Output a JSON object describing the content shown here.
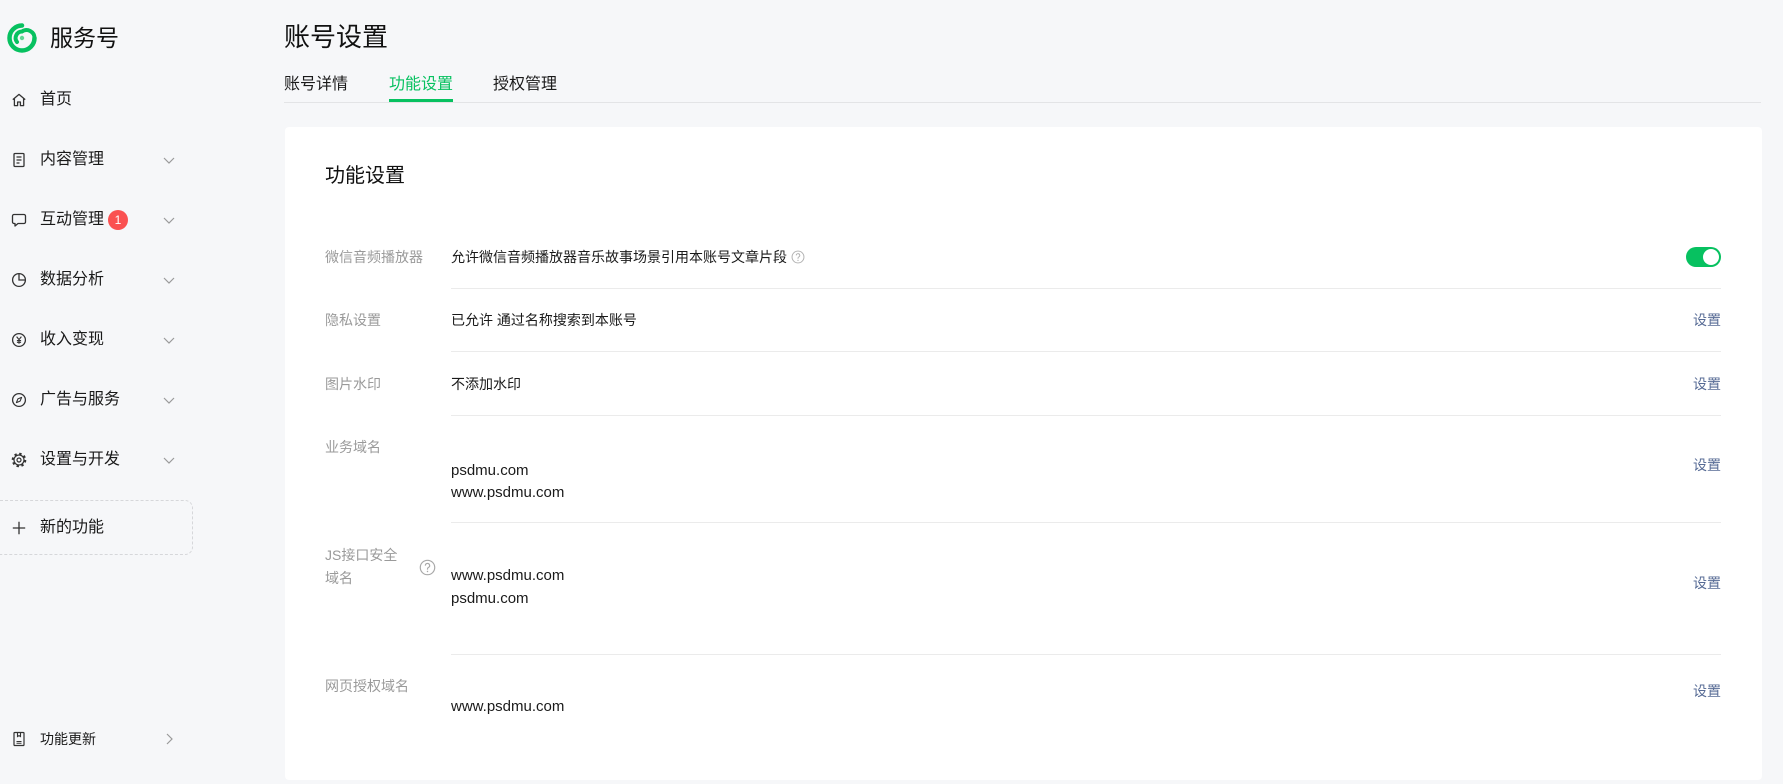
{
  "app": {
    "name": "服务号",
    "logo": "service-account-logo"
  },
  "sidebar": {
    "items": [
      {
        "label": "首页",
        "icon": "home-icon"
      },
      {
        "label": "内容管理",
        "icon": "document-icon",
        "expandable": true
      },
      {
        "label": "互动管理",
        "icon": "chat-icon",
        "badge": "1",
        "expandable": true
      },
      {
        "label": "数据分析",
        "icon": "pie-chart-icon",
        "expandable": true
      },
      {
        "label": "收入变现",
        "icon": "yuan-icon",
        "expandable": true
      },
      {
        "label": "广告与服务",
        "icon": "compass-icon",
        "expandable": true
      },
      {
        "label": "设置与开发",
        "icon": "gear-icon",
        "expandable": true
      }
    ],
    "new_feature": {
      "label": "新的功能",
      "icon": "plus-icon"
    },
    "updates": {
      "label": "功能更新",
      "icon": "notebook-icon"
    }
  },
  "page": {
    "title": "账号设置"
  },
  "tabs": [
    {
      "label": "账号详情",
      "active": false
    },
    {
      "label": "功能设置",
      "active": true
    },
    {
      "label": "授权管理",
      "active": false
    }
  ],
  "section": {
    "title": "功能设置",
    "rows": [
      {
        "label": "微信音频播放器",
        "text": "允许微信音频播放器音乐故事场景引用本账号文章片段",
        "help": true,
        "toggle_on": true
      },
      {
        "label": "隐私设置",
        "text": "已允许 通过名称搜索到本账号",
        "action": "设置"
      },
      {
        "label": "图片水印",
        "text": "不添加水印",
        "action": "设置"
      },
      {
        "label": "业务域名",
        "values": [
          "psdmu.com",
          "www.psdmu.com"
        ],
        "action": "设置"
      },
      {
        "label": "JS接口安全域名",
        "help": true,
        "values": [
          "www.psdmu.com",
          "psdmu.com"
        ],
        "action": "设置"
      },
      {
        "label": "网页授权域名",
        "values": [
          "www.psdmu.com"
        ],
        "action": "设置"
      }
    ]
  },
  "colors": {
    "brand": "#07c160",
    "link": "#576b95",
    "badge": "#fa5151",
    "text": "#1a1a1a",
    "muted": "#999999"
  }
}
